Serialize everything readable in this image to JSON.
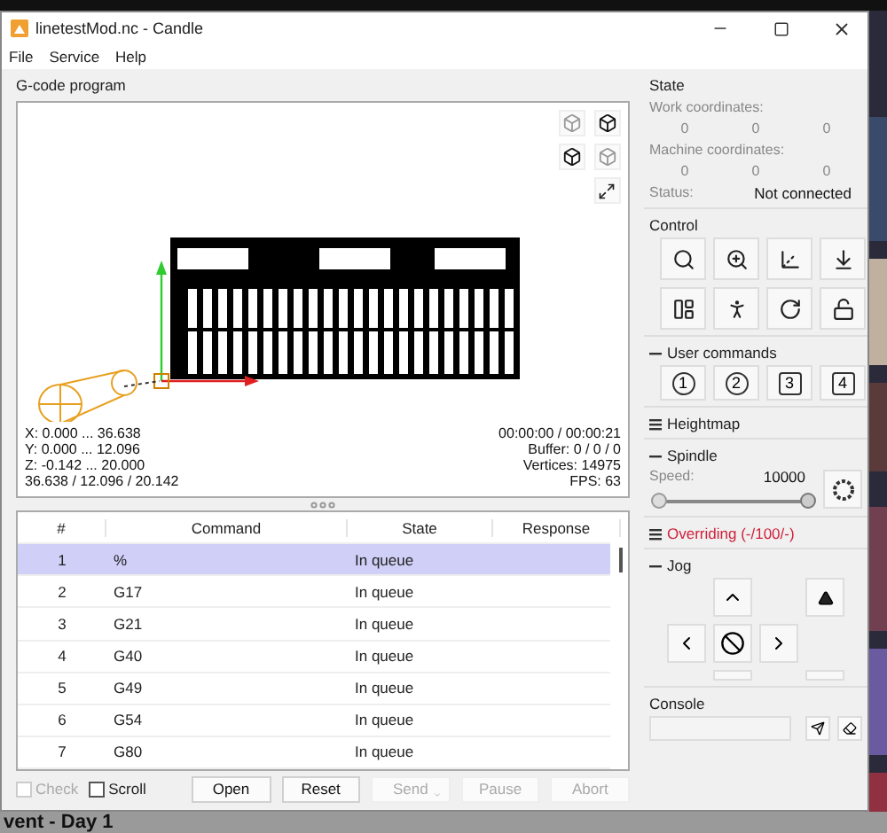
{
  "window": {
    "title": "linetestMod.nc - Candle"
  },
  "menu": [
    "File",
    "Service",
    "Help"
  ],
  "program": {
    "title": "G-code program",
    "stats_left": [
      "X: 0.000 ... 36.638",
      "Y: 0.000 ... 12.096",
      "Z: -0.142 ... 20.000",
      "36.638 / 12.096 / 20.142"
    ],
    "stats_right": [
      "00:00:00 / 00:00:21",
      "Buffer: 0 / 0 / 0",
      "Vertices: 14975",
      "FPS: 63"
    ]
  },
  "table": {
    "columns": [
      "#",
      "Command",
      "State",
      "Response"
    ],
    "rows": [
      {
        "cells": [
          "1",
          "%",
          "In queue",
          ""
        ],
        "selected": true
      },
      {
        "cells": [
          "2",
          "G17",
          "In queue",
          ""
        ],
        "selected": false
      },
      {
        "cells": [
          "3",
          "G21",
          "In queue",
          ""
        ],
        "selected": false
      },
      {
        "cells": [
          "4",
          "G40",
          "In queue",
          ""
        ],
        "selected": false
      },
      {
        "cells": [
          "5",
          "G49",
          "In queue",
          ""
        ],
        "selected": false
      },
      {
        "cells": [
          "6",
          "G54",
          "In queue",
          ""
        ],
        "selected": false
      },
      {
        "cells": [
          "7",
          "G80",
          "In queue",
          ""
        ],
        "selected": false
      }
    ]
  },
  "bottom_bar": {
    "checks": [
      {
        "label": "Check",
        "checked": false,
        "disabled": true
      },
      {
        "label": "Scroll",
        "checked": false,
        "disabled": false
      }
    ],
    "buttons": [
      {
        "label": "Open",
        "disabled": false,
        "menu": false
      },
      {
        "label": "Reset",
        "disabled": false,
        "menu": false
      },
      {
        "label": "Send",
        "disabled": true,
        "menu": true
      },
      {
        "label": "Pause",
        "disabled": true,
        "menu": false
      },
      {
        "label": "Abort",
        "disabled": true,
        "menu": false
      }
    ]
  },
  "state": {
    "title": "State",
    "work_label": "Work coordinates:",
    "work": [
      "0",
      "0",
      "0"
    ],
    "machine_label": "Machine coordinates:",
    "machine": [
      "0",
      "0",
      "0"
    ],
    "status_label": "Status:",
    "status": "Not connected"
  },
  "control": {
    "title": "Control"
  },
  "user_commands": {
    "title": "User commands",
    "expanded": true,
    "buttons": [
      {
        "label": "1",
        "kind": "round"
      },
      {
        "label": "2",
        "kind": "round"
      },
      {
        "label": "3",
        "kind": "square"
      },
      {
        "label": "4",
        "kind": "square"
      }
    ]
  },
  "heightmap": {
    "title": "Heightmap",
    "expanded": false
  },
  "spindle": {
    "title": "Spindle",
    "expanded": true,
    "speed_label": "Speed:",
    "speed": "10000",
    "level": 1
  },
  "overriding": {
    "title": "Overriding (-/100/-)",
    "expanded": false,
    "alert": true
  },
  "jog": {
    "title": "Jog",
    "expanded": true
  },
  "console": {
    "title": "Console"
  },
  "desktop": {
    "caption": "vent - Day 1"
  }
}
